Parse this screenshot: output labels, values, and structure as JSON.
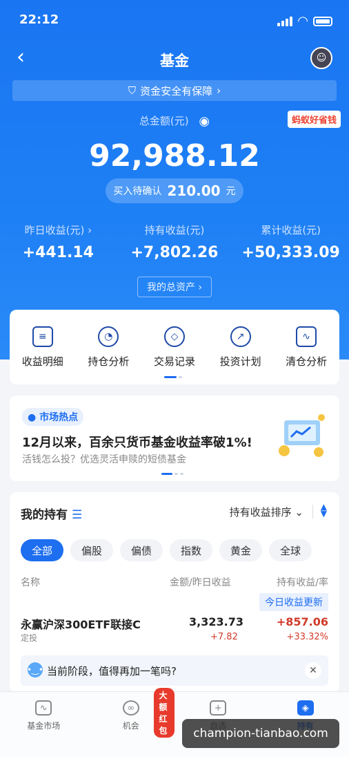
{
  "status": {
    "time": "22:12"
  },
  "nav": {
    "title": "基金",
    "back": "‹"
  },
  "safety": {
    "text": "资金安全有保障",
    "arrow": "›"
  },
  "total": {
    "label": "总金额(元)",
    "value": "92,988.12",
    "badge": "蚂蚁好省钱"
  },
  "pending": {
    "label": "买入待确认",
    "amount": "210.00",
    "unit": "元"
  },
  "stats": [
    {
      "label": "昨日收益(元) ›",
      "value": "+441.14"
    },
    {
      "label": "持有收益(元)",
      "value": "+7,802.26"
    },
    {
      "label": "累计收益(元)",
      "value": "+50,333.09"
    }
  ],
  "my_assets": "我的总资产 ›",
  "tools": [
    {
      "label": "收益明细",
      "icon": "receipt-icon"
    },
    {
      "label": "持仓分析",
      "icon": "pie-chart-icon"
    },
    {
      "label": "交易记录",
      "icon": "record-icon"
    },
    {
      "label": "投资计划",
      "icon": "trend-icon"
    },
    {
      "label": "清仓分析",
      "icon": "analysis-icon"
    }
  ],
  "market": {
    "tag": "市场热点",
    "headline": "12月以来，百余只货币基金收益率破1%!",
    "subtitle": "活钱怎么投？优选灵活申赎的短债基金"
  },
  "holdings": {
    "title": "我的持有",
    "sort_label": "持有收益排序",
    "chips": [
      "全部",
      "偏股",
      "偏债",
      "指数",
      "黄金",
      "全球"
    ],
    "col_name": "名称",
    "col_amount": "金额/昨日收益",
    "col_profit": "持有收益/率",
    "update": "今日收益更新",
    "rows": [
      {
        "name": "永赢沪深300ETF联接C",
        "sub": "定投",
        "amount": "3,323.73",
        "yesterday": "+7.82",
        "profit": "+857.06",
        "rate": "+33.32%"
      }
    ],
    "tip": "当前阶段，值得再加一笔吗?"
  },
  "tabbar": [
    {
      "label": "基金市场",
      "icon": "market-icon"
    },
    {
      "label": "机会",
      "icon": "opportunity-icon",
      "badge": "大额红包"
    },
    {
      "label": "自选",
      "icon": "favorites-icon"
    },
    {
      "label": "持有",
      "icon": "holdings-icon"
    }
  ],
  "watermark": "champion-tianbao.com",
  "colors": {
    "primary": "#1e6ef0",
    "gain": "#d03a2a"
  }
}
